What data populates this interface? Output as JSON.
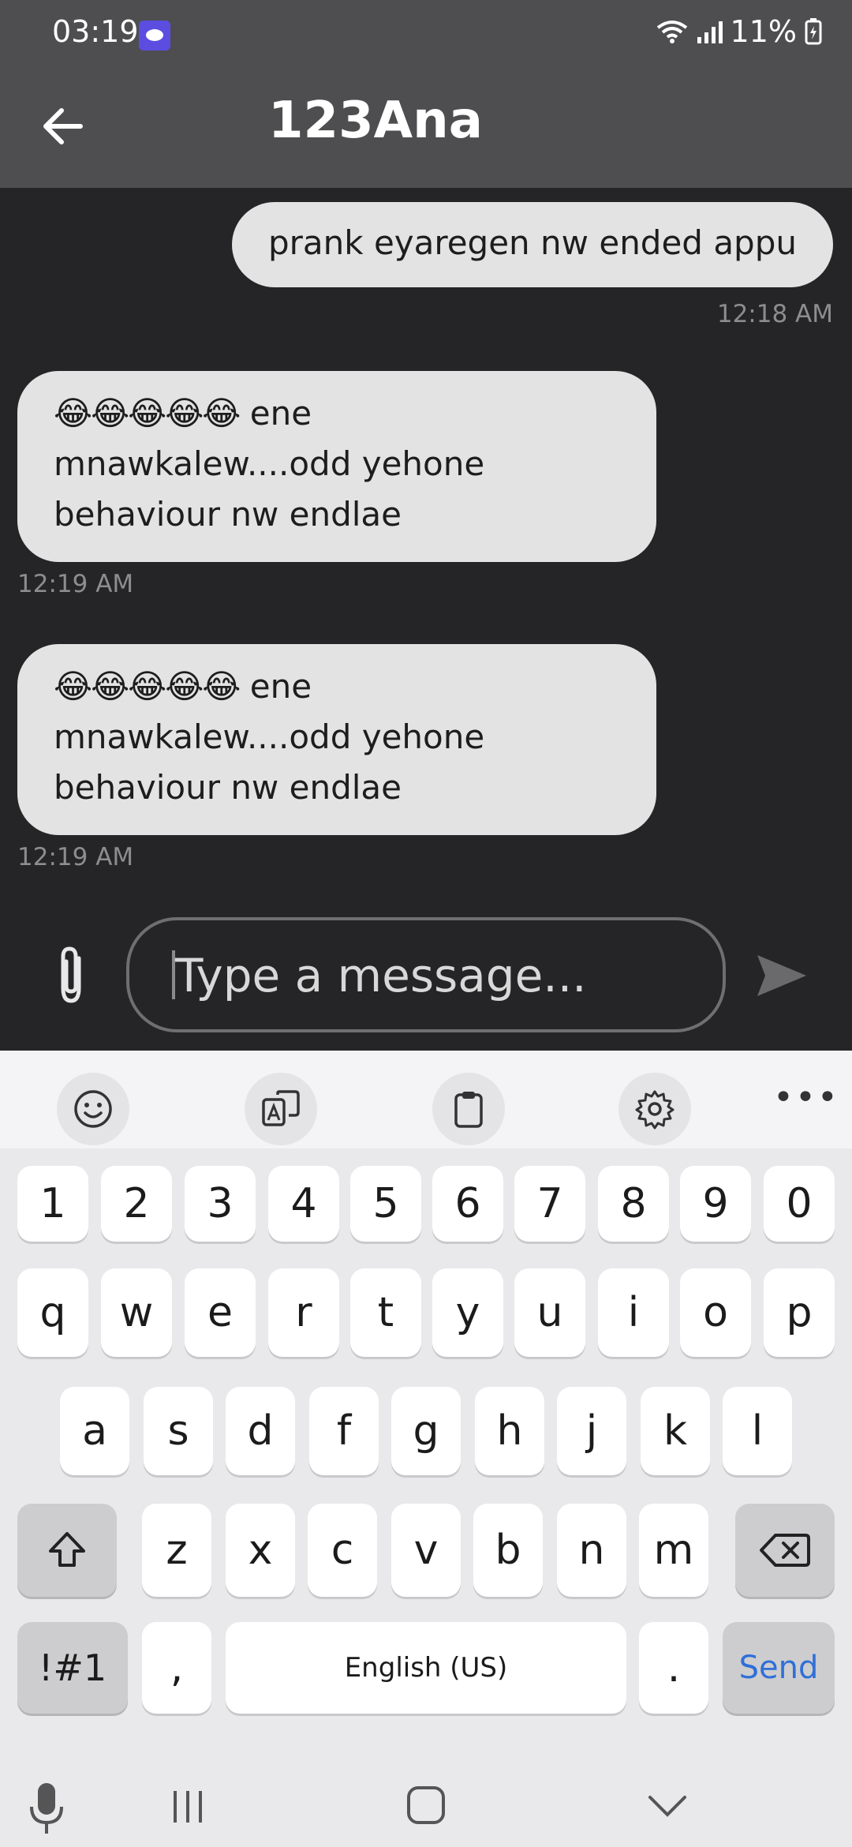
{
  "status_bar": {
    "time": "03:19",
    "battery": "11%"
  },
  "header": {
    "title": "123Ana"
  },
  "messages": [
    {
      "direction": "sent",
      "text": "prank eyaregen nw ended appu",
      "time": "12:18 AM"
    },
    {
      "direction": "received",
      "emoji": "😂😂😂😂😂",
      "lines": [
        "ene",
        "mnawkalew....odd yehone",
        "behaviour nw endlae"
      ],
      "time": "12:19 AM"
    },
    {
      "direction": "received",
      "emoji": "😂😂😂😂😂",
      "lines": [
        "ene",
        "mnawkalew....odd yehone",
        "behaviour nw endlae"
      ],
      "time": "12:19 AM"
    }
  ],
  "composer": {
    "placeholder": "Type a message..."
  },
  "keyboard": {
    "toolbar": [
      "emoji-icon",
      "translate-icon",
      "clipboard-icon",
      "settings-icon",
      "more-icon"
    ],
    "row_numbers": [
      "1",
      "2",
      "3",
      "4",
      "5",
      "6",
      "7",
      "8",
      "9",
      "0"
    ],
    "row_top": [
      "q",
      "w",
      "e",
      "r",
      "t",
      "y",
      "u",
      "i",
      "o",
      "p"
    ],
    "row_middle": [
      "a",
      "s",
      "d",
      "f",
      "g",
      "h",
      "j",
      "k",
      "l"
    ],
    "row_bottom": [
      "z",
      "x",
      "c",
      "v",
      "b",
      "n",
      "m"
    ],
    "symbols_label": "!#1",
    "comma": ",",
    "space_label": "English (US)",
    "period": ".",
    "send_label": "Send"
  },
  "colors": {
    "accent": "#2f6fd8",
    "bubble": "#e3e3e3",
    "chat_bg": "#252527",
    "header_bg": "#4e4e50"
  }
}
